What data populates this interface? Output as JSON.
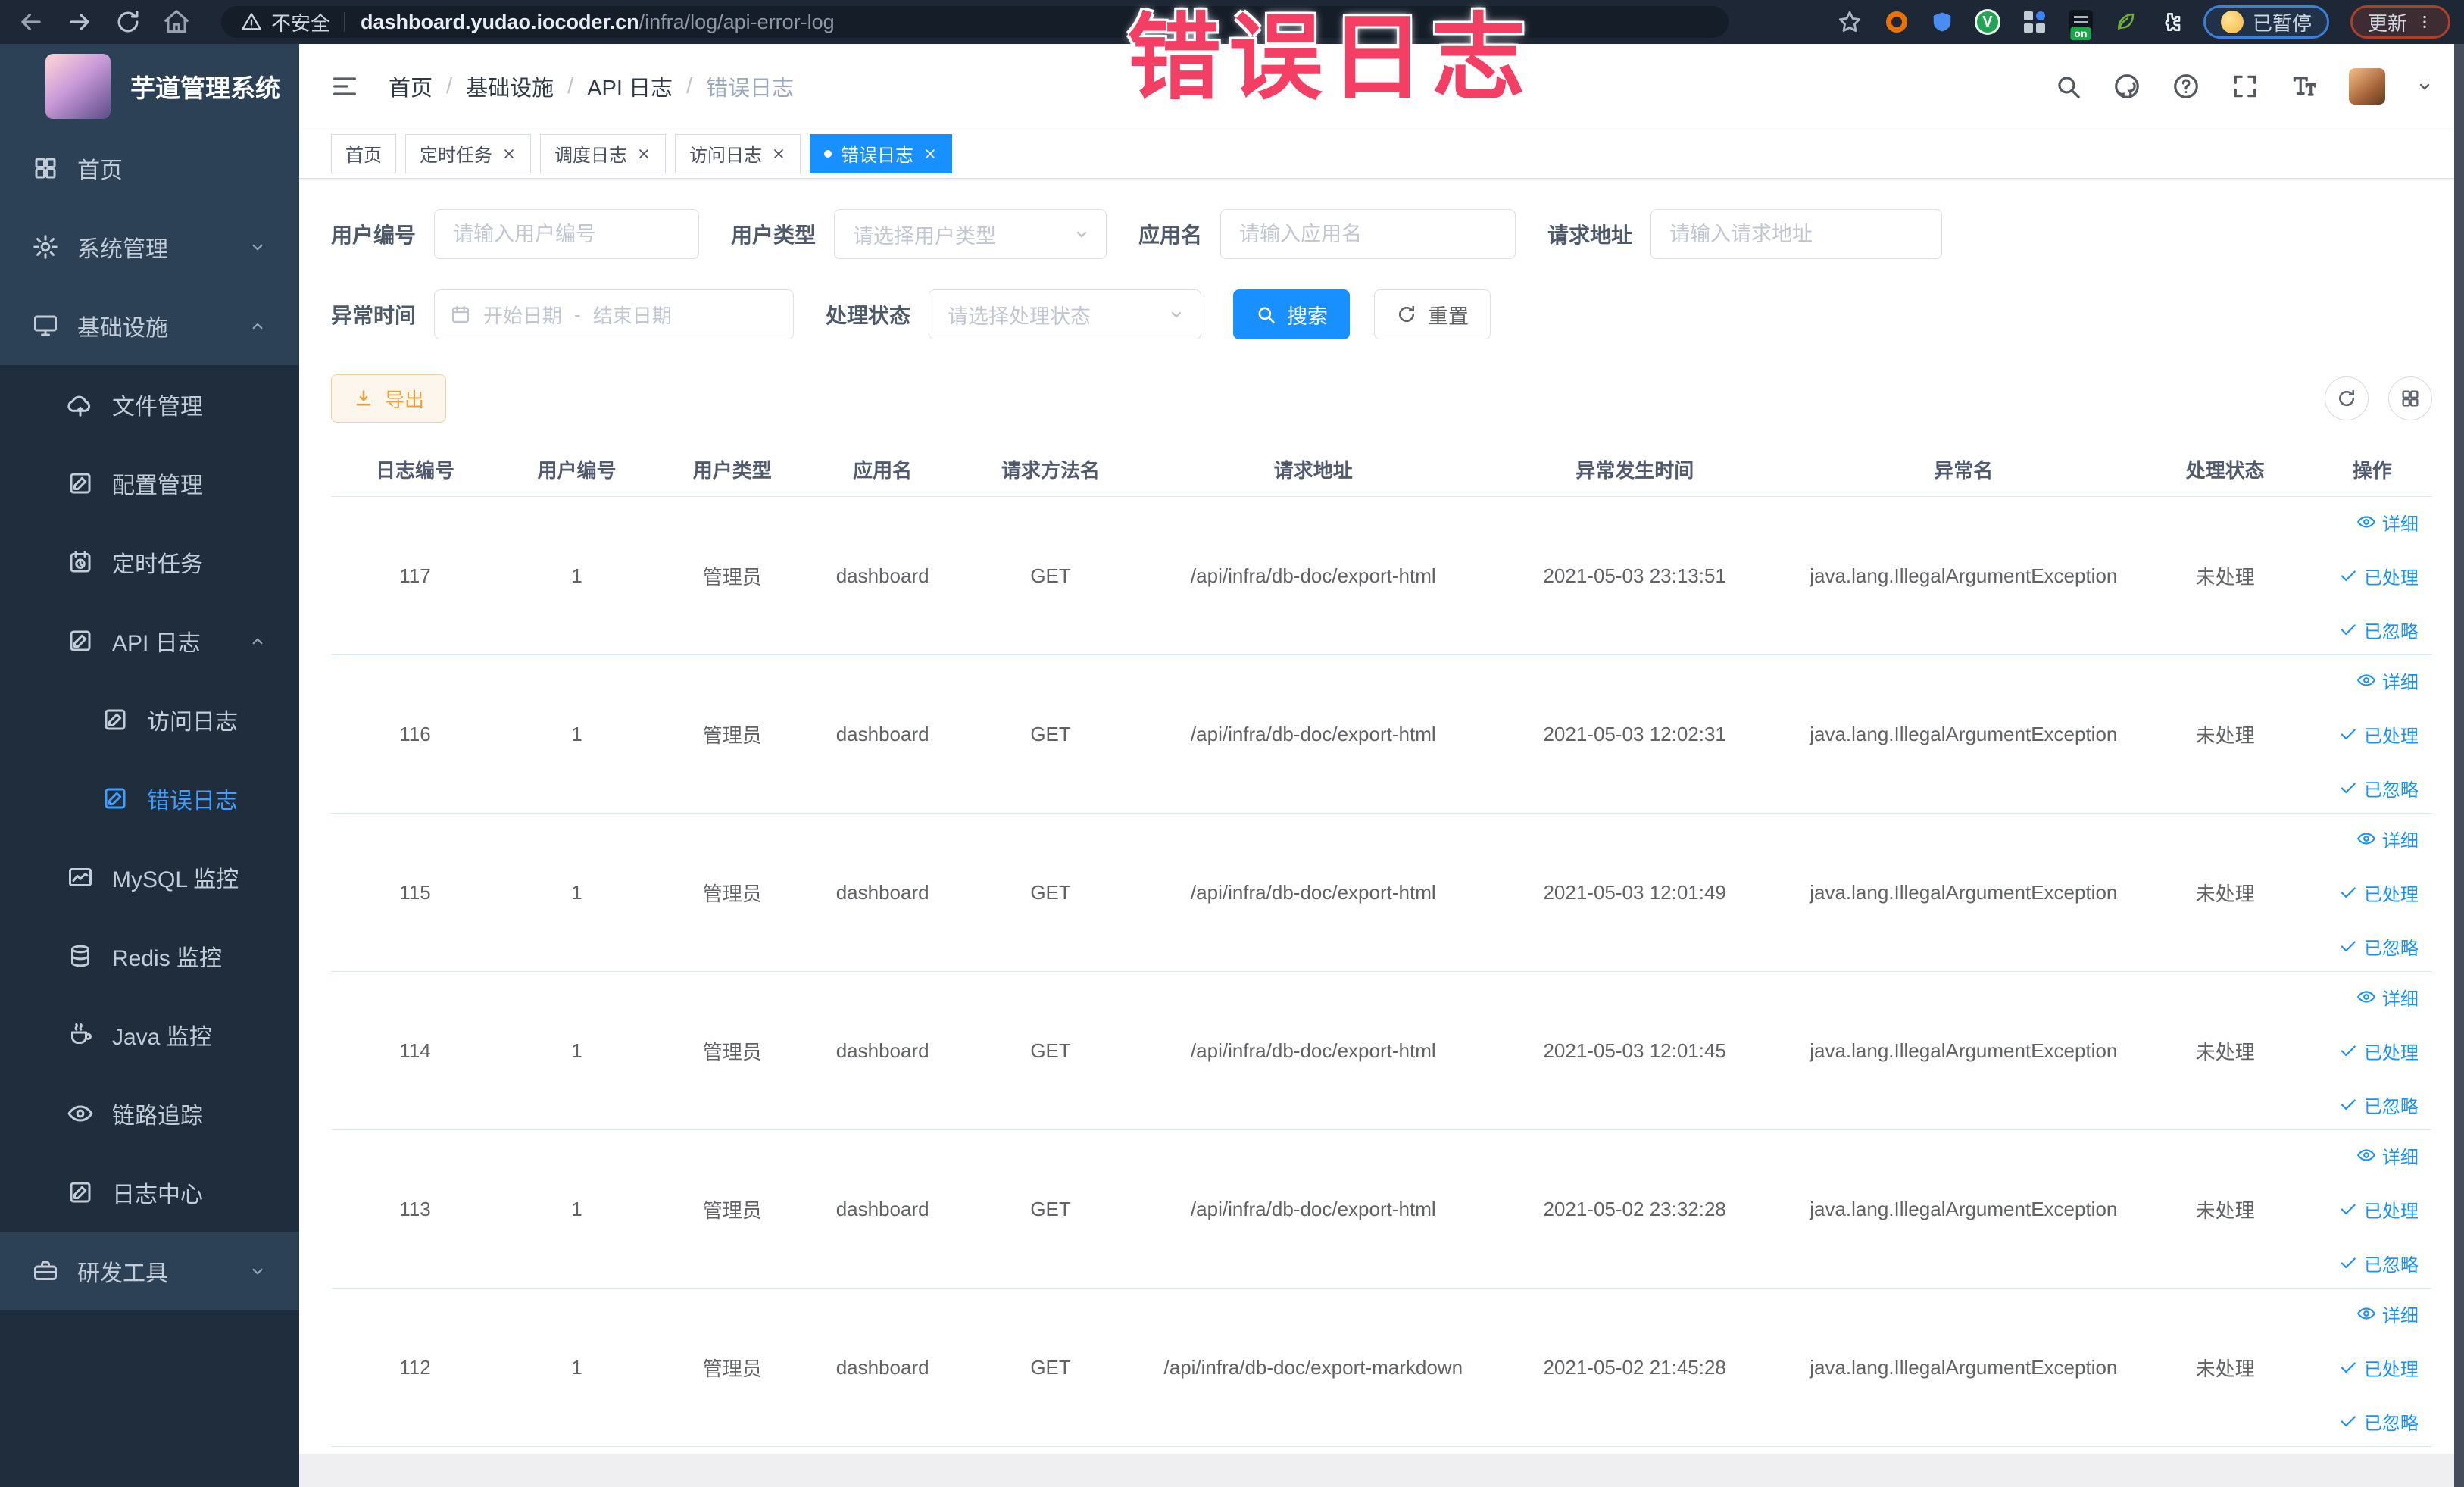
{
  "browser": {
    "security_label": "不安全",
    "url_host": "dashboard.yudao.iocoder.cn",
    "url_path": "/infra/log/api-error-log",
    "paused_label": "已暂停",
    "update_label": "更新",
    "green_ext_letter": "V",
    "on_badge": "on"
  },
  "overlay": {
    "text": "错误日志",
    "color": "#f23f63"
  },
  "sidebar": {
    "logo_title": "芋道管理系统",
    "items": [
      {
        "id": "home",
        "label": "首页",
        "level": 0,
        "icon": "home",
        "chevron": null,
        "active": false
      },
      {
        "id": "system",
        "label": "系统管理",
        "level": 0,
        "icon": "gear",
        "chevron": "down",
        "active": false
      },
      {
        "id": "infra",
        "label": "基础设施",
        "level": 0,
        "icon": "monitor",
        "chevron": "up",
        "active": false
      },
      {
        "id": "file",
        "label": "文件管理",
        "level": 1,
        "icon": "cloud",
        "chevron": null,
        "active": false
      },
      {
        "id": "config",
        "label": "配置管理",
        "level": 1,
        "icon": "edit",
        "chevron": null,
        "active": false
      },
      {
        "id": "job",
        "label": "定时任务",
        "level": 1,
        "icon": "timer",
        "chevron": null,
        "active": false
      },
      {
        "id": "api-log",
        "label": "API 日志",
        "level": 1,
        "icon": "edit",
        "chevron": "up",
        "active": false
      },
      {
        "id": "access-log",
        "label": "访问日志",
        "level": 2,
        "icon": "edit",
        "chevron": null,
        "active": false
      },
      {
        "id": "error-log",
        "label": "错误日志",
        "level": 2,
        "icon": "edit",
        "chevron": null,
        "active": true
      },
      {
        "id": "mysql",
        "label": "MySQL 监控",
        "level": 1,
        "icon": "chart",
        "chevron": null,
        "active": false
      },
      {
        "id": "redis",
        "label": "Redis 监控",
        "level": 1,
        "icon": "stack",
        "chevron": null,
        "active": false
      },
      {
        "id": "java",
        "label": "Java 监控",
        "level": 1,
        "icon": "java",
        "chevron": null,
        "active": false
      },
      {
        "id": "trace",
        "label": "链路追踪",
        "level": 1,
        "icon": "eye",
        "chevron": null,
        "active": false
      },
      {
        "id": "log-center",
        "label": "日志中心",
        "level": 1,
        "icon": "edit",
        "chevron": null,
        "active": false
      },
      {
        "id": "dev-tools",
        "label": "研发工具",
        "level": 0,
        "icon": "toolbox",
        "chevron": "down",
        "active": false
      }
    ]
  },
  "header": {
    "breadcrumb": [
      "首页",
      "基础设施",
      "API 日志",
      "错误日志"
    ]
  },
  "tabs": [
    {
      "label": "首页",
      "closable": false,
      "active": false
    },
    {
      "label": "定时任务",
      "closable": true,
      "active": false
    },
    {
      "label": "调度日志",
      "closable": true,
      "active": false
    },
    {
      "label": "访问日志",
      "closable": true,
      "active": false
    },
    {
      "label": "错误日志",
      "closable": true,
      "active": true
    }
  ],
  "filters": {
    "user_id": {
      "label": "用户编号",
      "placeholder": "请输入用户编号"
    },
    "user_type": {
      "label": "用户类型",
      "placeholder": "请选择用户类型"
    },
    "app_name": {
      "label": "应用名",
      "placeholder": "请输入应用名"
    },
    "request_url": {
      "label": "请求地址",
      "placeholder": "请输入请求地址"
    },
    "exception_time": {
      "label": "异常时间",
      "start_placeholder": "开始日期",
      "separator": "-",
      "end_placeholder": "结束日期"
    },
    "process_status": {
      "label": "处理状态",
      "placeholder": "请选择处理状态"
    },
    "search_label": "搜索",
    "reset_label": "重置"
  },
  "toolbar": {
    "export_label": "导出"
  },
  "table": {
    "columns": [
      {
        "key": "log_id",
        "label": "日志编号",
        "width": 8.0
      },
      {
        "key": "user_id",
        "label": "用户编号",
        "width": 7.4
      },
      {
        "key": "user_type",
        "label": "用户类型",
        "width": 7.4
      },
      {
        "key": "app_name",
        "label": "应用名",
        "width": 6.9
      },
      {
        "key": "method",
        "label": "请求方法名",
        "width": 9.1
      },
      {
        "key": "request_url",
        "label": "请求地址",
        "width": 15.9
      },
      {
        "key": "time",
        "label": "异常发生时间",
        "width": 14.7
      },
      {
        "key": "exception",
        "label": "异常名",
        "width": 16.6
      },
      {
        "key": "status",
        "label": "处理状态",
        "width": 8.3
      },
      {
        "key": "_actions",
        "label": "操作",
        "width": 5.7
      }
    ],
    "rows": [
      {
        "log_id": "117",
        "user_id": "1",
        "user_type": "管理员",
        "app_name": "dashboard",
        "method": "GET",
        "request_url": "/api/infra/db-doc/export-html",
        "time": "2021-05-03 23:13:51",
        "exception": "java.lang.IllegalArgumentException",
        "status": "未处理"
      },
      {
        "log_id": "116",
        "user_id": "1",
        "user_type": "管理员",
        "app_name": "dashboard",
        "method": "GET",
        "request_url": "/api/infra/db-doc/export-html",
        "time": "2021-05-03 12:02:31",
        "exception": "java.lang.IllegalArgumentException",
        "status": "未处理"
      },
      {
        "log_id": "115",
        "user_id": "1",
        "user_type": "管理员",
        "app_name": "dashboard",
        "method": "GET",
        "request_url": "/api/infra/db-doc/export-html",
        "time": "2021-05-03 12:01:49",
        "exception": "java.lang.IllegalArgumentException",
        "status": "未处理"
      },
      {
        "log_id": "114",
        "user_id": "1",
        "user_type": "管理员",
        "app_name": "dashboard",
        "method": "GET",
        "request_url": "/api/infra/db-doc/export-html",
        "time": "2021-05-03 12:01:45",
        "exception": "java.lang.IllegalArgumentException",
        "status": "未处理"
      },
      {
        "log_id": "113",
        "user_id": "1",
        "user_type": "管理员",
        "app_name": "dashboard",
        "method": "GET",
        "request_url": "/api/infra/db-doc/export-html",
        "time": "2021-05-02 23:32:28",
        "exception": "java.lang.IllegalArgumentException",
        "status": "未处理"
      },
      {
        "log_id": "112",
        "user_id": "1",
        "user_type": "管理员",
        "app_name": "dashboard",
        "method": "GET",
        "request_url": "/api/infra/db-doc/export-markdown",
        "time": "2021-05-02 21:45:28",
        "exception": "java.lang.IllegalArgumentException",
        "status": "未处理"
      }
    ],
    "row_actions": [
      {
        "name": "detail",
        "label": "详细",
        "icon": "eye"
      },
      {
        "name": "processed",
        "label": "已处理",
        "icon": "check"
      },
      {
        "name": "ignored",
        "label": "已忽略",
        "icon": "check"
      }
    ]
  },
  "colors": {
    "accent": "#1890ff",
    "menu_active": "#409eff",
    "export": "#e6a23c",
    "row_border": "#d6ebfa",
    "overlay_pink": "#f23f63"
  }
}
